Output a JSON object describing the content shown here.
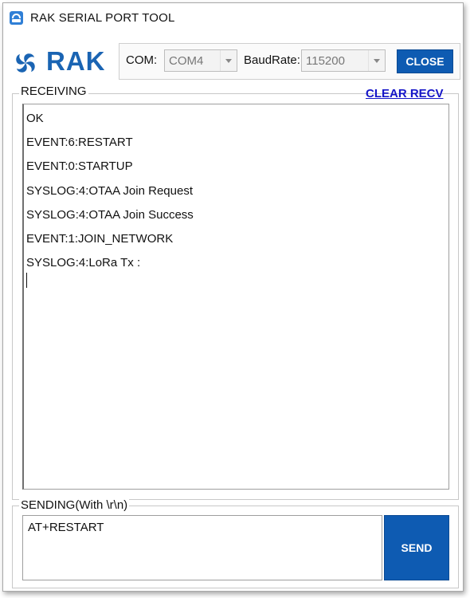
{
  "window": {
    "title": "RAK SERIAL PORT TOOL"
  },
  "brand": {
    "logo_text": "RAK",
    "color": "#1a64b3"
  },
  "port": {
    "com_label": "COM:",
    "com_value": "COM4",
    "baud_label": "BaudRate:",
    "baud_value": "115200",
    "close_label": "CLOSE"
  },
  "receiving": {
    "legend": "RECEIVING",
    "clear_label": "CLEAR RECV",
    "lines": [
      "OK",
      "EVENT:6:RESTART",
      "EVENT:0:STARTUP",
      "SYSLOG:4:OTAA Join Request",
      "SYSLOG:4:OTAA Join Success",
      "EVENT:1:JOIN_NETWORK",
      "SYSLOG:4:LoRa Tx :"
    ]
  },
  "sending": {
    "legend": "SENDING(With \\r\\n)",
    "text": "AT+RESTART",
    "send_label": "SEND"
  },
  "colors": {
    "accent": "#0e5bb2",
    "link": "#1515c8"
  }
}
